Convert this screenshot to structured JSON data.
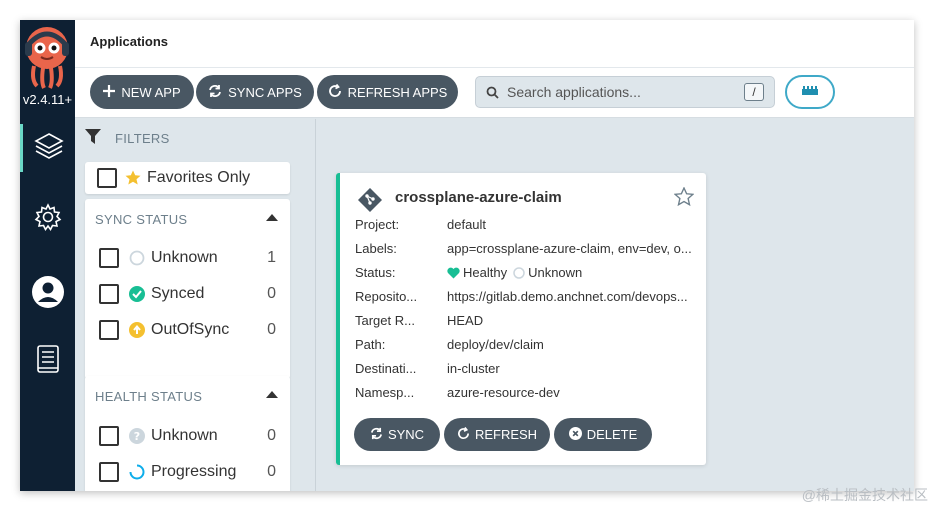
{
  "app": {
    "version": "v2.4.11+",
    "page_title": "Applications",
    "accent": "#18be94",
    "button_color": "#495763"
  },
  "sidebar": {
    "items": [
      {
        "name": "applications",
        "icon": "layers-icon",
        "active": true
      },
      {
        "name": "settings",
        "icon": "gear-icon",
        "active": false
      },
      {
        "name": "user-info",
        "icon": "user-icon",
        "active": false
      },
      {
        "name": "documentation",
        "icon": "book-icon",
        "active": false
      }
    ]
  },
  "toolbar": {
    "new_app": "NEW APP",
    "sync_apps": "SYNC APPS",
    "refresh_apps": "REFRESH APPS",
    "search_placeholder": "Search applications...",
    "search_shortcut": "/"
  },
  "filters": {
    "header": "FILTERS",
    "favorites_label": "Favorites Only",
    "sync_status": {
      "title": "SYNC STATUS",
      "items": [
        {
          "label": "Unknown",
          "count": "1",
          "icon": "circle-outline-icon"
        },
        {
          "label": "Synced",
          "count": "0",
          "icon": "check-circle-icon"
        },
        {
          "label": "OutOfSync",
          "count": "0",
          "icon": "arrow-up-circle-icon"
        }
      ]
    },
    "health_status": {
      "title": "HEALTH STATUS",
      "items": [
        {
          "label": "Unknown",
          "count": "0",
          "icon": "question-circle-icon"
        },
        {
          "label": "Progressing",
          "count": "0",
          "icon": "spinner-icon"
        }
      ]
    }
  },
  "application": {
    "name": "crossplane-azure-claim",
    "fields": [
      {
        "key": "Project:",
        "value": "default"
      },
      {
        "key": "Labels:",
        "value": "app=crossplane-azure-claim, env=dev, o..."
      },
      {
        "key": "Status:",
        "health": "Healthy",
        "sync": "Unknown"
      },
      {
        "key": "Reposito...",
        "value": "https://gitlab.demo.anchnet.com/devops..."
      },
      {
        "key": "Target R...",
        "value": "HEAD"
      },
      {
        "key": "Path:",
        "value": "deploy/dev/claim"
      },
      {
        "key": "Destinati...",
        "value": "in-cluster"
      },
      {
        "key": "Namesp...",
        "value": "azure-resource-dev"
      }
    ],
    "actions": {
      "sync": "SYNC",
      "refresh": "REFRESH",
      "delete": "DELETE"
    }
  },
  "watermark": "@稀土掘金技术社区"
}
